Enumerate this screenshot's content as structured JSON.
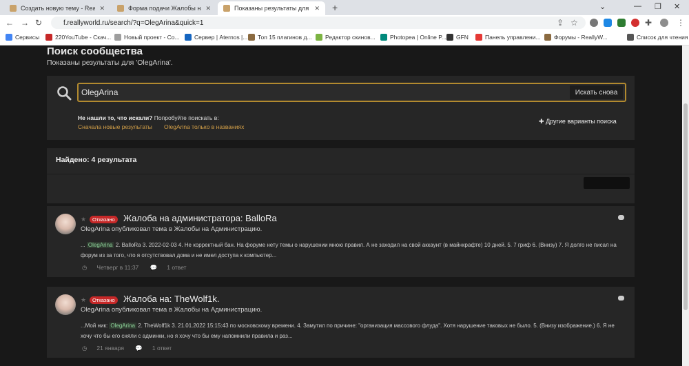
{
  "browser": {
    "tabs": [
      {
        "title": "Создать новую тему - ReallyWo",
        "active": false
      },
      {
        "title": "Форма подачи Жалобы на Адм",
        "active": false
      },
      {
        "title": "Показаны результаты для 'Oleg",
        "active": true
      }
    ],
    "url": "f.reallyworld.ru/search/?q=OlegArina&quick=1",
    "bookmarks": [
      "Сервисы",
      "220YouTube - Скач...",
      "Новый проект - Co...",
      "Сервер | Aternos |...",
      "Топ 15 плагинов д...",
      "Редактор скинов...",
      "Photopea | Online P...",
      "GFN",
      "Панель управлени...",
      "Форумы - ReallyW..."
    ],
    "reading_list": "Список для чтения"
  },
  "page": {
    "title": "Поиск сообщества",
    "subtitle": "Показаны результаты для 'OlegArina'.",
    "search": {
      "value": "OlegArina",
      "button": "Искать снова",
      "not_found_bold": "Не нашли то, что искали?",
      "not_found_rest": " Попробуйте поискать в:",
      "suggestion_1": "Сначала новые результаты",
      "suggestion_2": "OlegArina только в названиях",
      "more_options": "Другие варианты поиска"
    },
    "found": "Найдено: 4 результата",
    "results": [
      {
        "badge": "Отказано",
        "title": "Жалоба на администратора: BalloRa",
        "byline": "OlegArina опубликовал тема в Жалобы на Администрацию.",
        "body_pre": "... ",
        "highlight": "OlegArina",
        "body_post": " 2. BalloRa 3. 2022-02-03 4. Не корректный бан. На форуме нету темы о нарушении мною правил. А не заходил на свой аккаунт (в майнкрафте) 10 дней. 5. 7 гриф 6. (Внизу) 7. Я долго не писал на форум из за того, что я отсутствовал дома и не имел доступа к компьютер...",
        "date": "Четверг в 11:37",
        "replies": "1 ответ"
      },
      {
        "badge": "Отказано",
        "title": "Жалоба на: TheWolf1k.",
        "byline": "OlegArina опубликовал тема в Жалобы на Администрацию.",
        "body_pre": "...Мой ник: ",
        "highlight": "OlegArina",
        "body_post": " 2. TheWolf1k 3. 21.01.2022 15:15:43 по московскому времени. 4. Замутил по причине: \"организация массового флуда\". Хотя нарушение таковых не было. 5. (Внизу изображение.) 6. Я не хочу что бы его сняли с админки, но я хочу что бы ему напомнили правила и раз...",
        "date": "21 января",
        "replies": "1 ответ"
      }
    ]
  }
}
